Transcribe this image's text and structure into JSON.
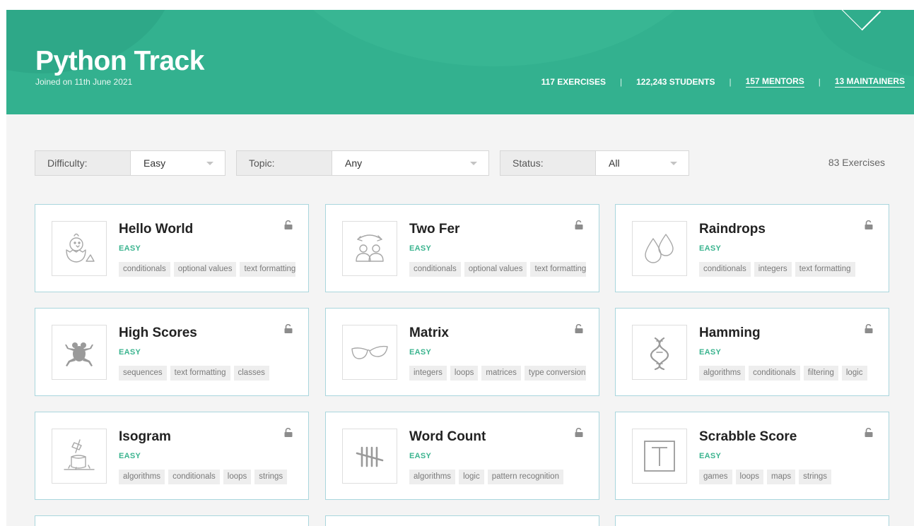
{
  "header": {
    "title": "Python Track",
    "subtitle": "Joined on 11th June 2021",
    "stats": {
      "exercises": "117 EXERCISES",
      "students": "122,243 STUDENTS",
      "mentors": "157 MENTORS",
      "maintainers": "13 MAINTAINERS"
    }
  },
  "filters": {
    "difficulty": {
      "label": "Difficulty:",
      "value": "Easy"
    },
    "topic": {
      "label": "Topic:",
      "value": "Any"
    },
    "status": {
      "label": "Status:",
      "value": "All"
    }
  },
  "exercise_count": "83 Exercises",
  "colors": {
    "accent": "#33b18f",
    "difficulty_easy": "#3bb48f",
    "card_border": "#a9d6dd"
  },
  "exercises": [
    {
      "title": "Hello World",
      "difficulty": "EASY",
      "icon": "chick-icon",
      "tags": [
        "conditionals",
        "optional values",
        "text formatting"
      ]
    },
    {
      "title": "Two Fer",
      "difficulty": "EASY",
      "icon": "two-people-icon",
      "tags": [
        "conditionals",
        "optional values",
        "text formatting"
      ]
    },
    {
      "title": "Raindrops",
      "difficulty": "EASY",
      "icon": "raindrops-icon",
      "tags": [
        "conditionals",
        "integers",
        "text formatting"
      ]
    },
    {
      "title": "High Scores",
      "difficulty": "EASY",
      "icon": "frog-icon",
      "tags": [
        "sequences",
        "text formatting",
        "classes"
      ]
    },
    {
      "title": "Matrix",
      "difficulty": "EASY",
      "icon": "glasses-icon",
      "tags": [
        "integers",
        "loops",
        "matrices",
        "type conversion"
      ]
    },
    {
      "title": "Hamming",
      "difficulty": "EASY",
      "icon": "dna-icon",
      "tags": [
        "algorithms",
        "conditionals",
        "filtering",
        "logic"
      ]
    },
    {
      "title": "Isogram",
      "difficulty": "EASY",
      "icon": "axe-stump-icon",
      "tags": [
        "algorithms",
        "conditionals",
        "loops",
        "strings"
      ]
    },
    {
      "title": "Word Count",
      "difficulty": "EASY",
      "icon": "tally-marks-icon",
      "tags": [
        "algorithms",
        "logic",
        "pattern recognition"
      ]
    },
    {
      "title": "Scrabble Score",
      "difficulty": "EASY",
      "icon": "letter-tile-icon",
      "tags": [
        "games",
        "loops",
        "maps",
        "strings"
      ]
    }
  ]
}
